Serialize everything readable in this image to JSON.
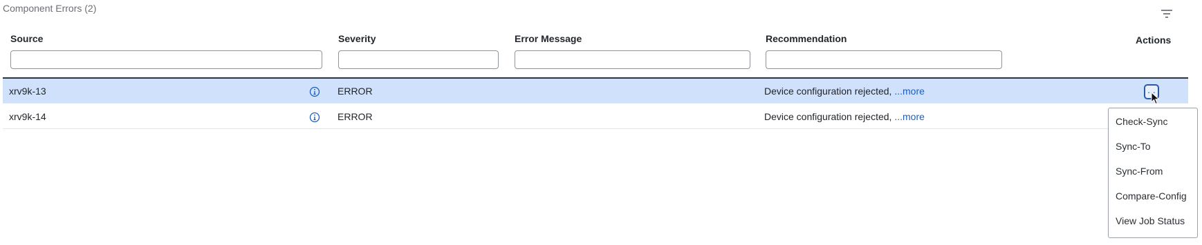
{
  "panel": {
    "title": "Component Errors (2)",
    "filter_icon": "filter-lines-icon"
  },
  "columns": {
    "source": "Source",
    "severity": "Severity",
    "error_message": "Error Message",
    "recommendation": "Recommendation",
    "actions": "Actions"
  },
  "filters": {
    "source": "",
    "severity": "",
    "error_message": "",
    "recommendation": ""
  },
  "rows": [
    {
      "source": "xrv9k-13",
      "severity": "ERROR",
      "error_message": "",
      "recommendation": "Device configuration rejected,",
      "more_label": "...more",
      "selected": true
    },
    {
      "source": "xrv9k-14",
      "severity": "ERROR",
      "error_message": "",
      "recommendation": "Device configuration rejected,",
      "more_label": "...more",
      "selected": false
    }
  ],
  "actions_button": {
    "label": "..."
  },
  "actions_menu": {
    "items": [
      "Check-Sync",
      "Sync-To",
      "Sync-From",
      "Compare-Config",
      "View Job Status"
    ]
  },
  "colors": {
    "selected_row": "#cfe1fb",
    "link": "#1d5fb8",
    "info_icon": "#1d5fb8"
  }
}
